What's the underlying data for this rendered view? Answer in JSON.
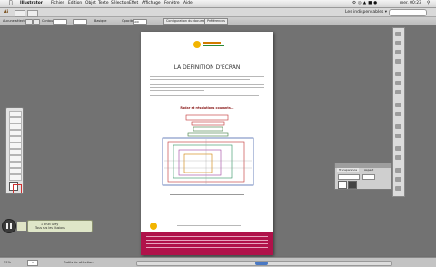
{
  "menubar": {
    "app_name": "Illustrator",
    "menus": [
      "Fichier",
      "Edition",
      "Objet",
      "Texte",
      "Sélection",
      "Effet",
      "Affichage",
      "Fenêtre",
      "Aide"
    ],
    "clock": "mer. 00:23"
  },
  "appbar": {
    "logo": "Ai",
    "workspace": "Les indispensables ▾"
  },
  "controlbar": {
    "label": "Aucune sélection",
    "stroke_label": "Contour :",
    "basic_label": "Basique",
    "opacity_label": "Opacité :",
    "opacity_value": "100",
    "doc_setup": "Configuration du document",
    "prefs": "Préférences"
  },
  "document": {
    "title": "LA DEFINITION D'ECRAN",
    "subtitle": "Radar et résolutions courants..."
  },
  "transparency_panel": {
    "tab1": "Transparence",
    "tab2": "Aspect"
  },
  "bridge_strip": {
    "line1": "1 Bruit Grey",
    "line2": "Tous ses les Illusions"
  },
  "statusbar": {
    "zoom": "59%",
    "page": "1",
    "mode": "Outils de sélection"
  },
  "colors": {
    "footer_band": "#b0124a",
    "workspace": "#727272"
  }
}
